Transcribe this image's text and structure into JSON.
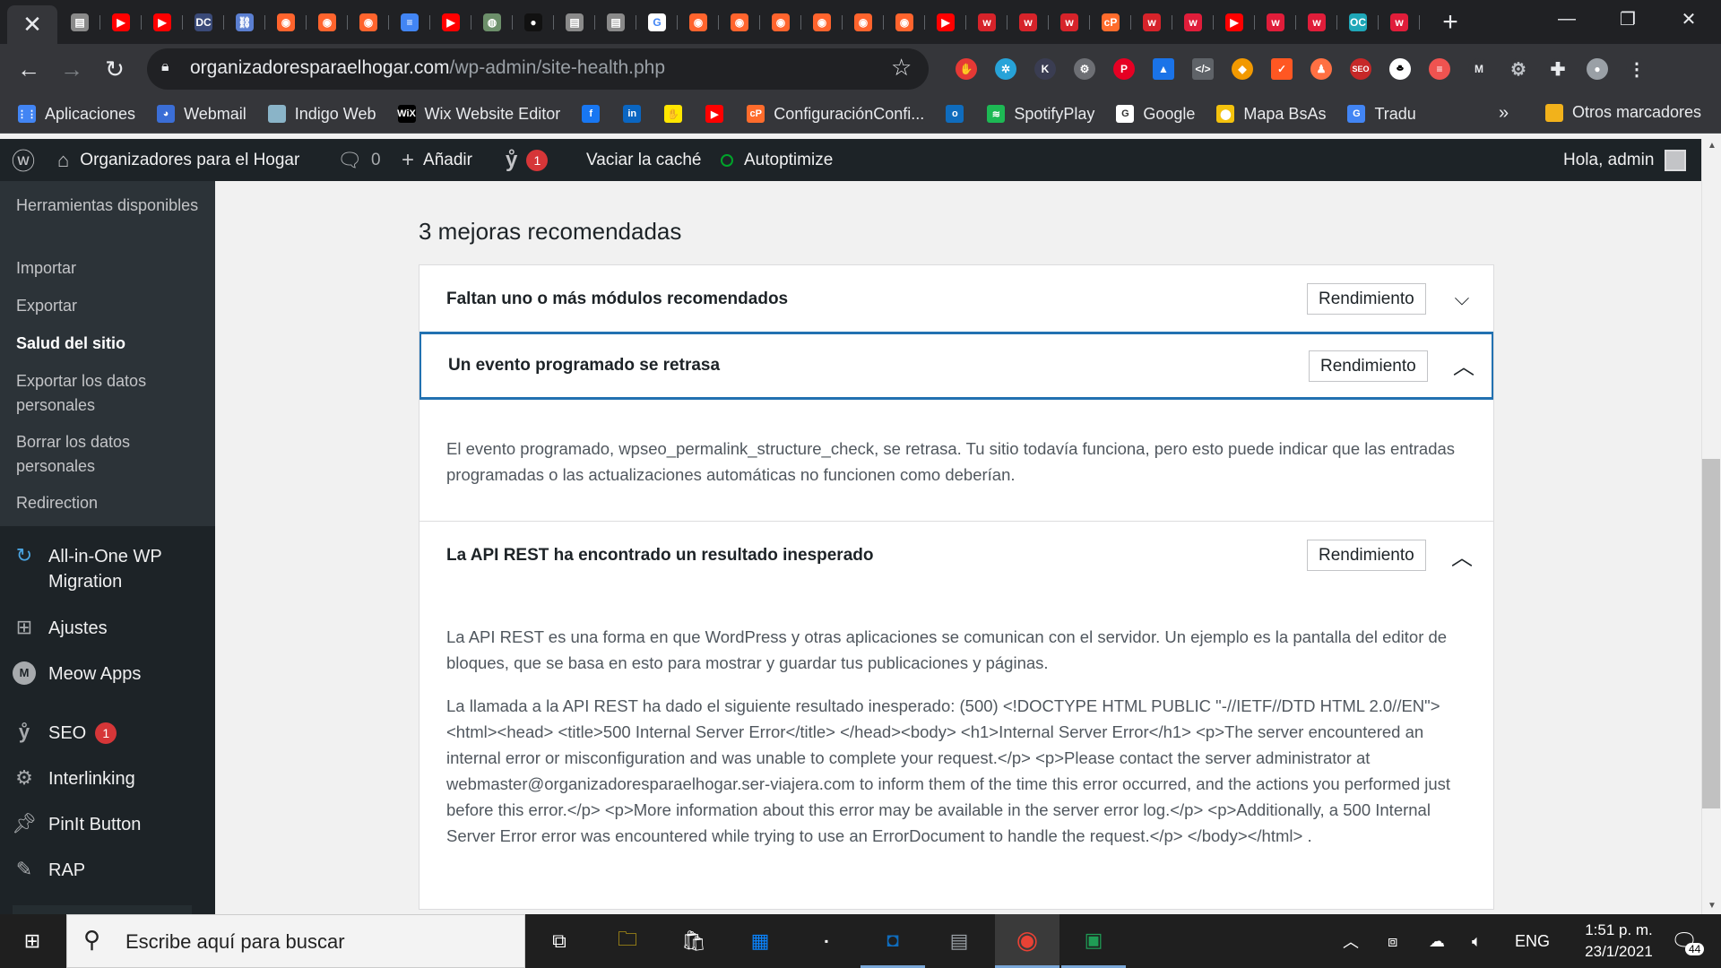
{
  "browser": {
    "tabs": [
      {
        "icon": "doc-icon",
        "color": "#8a8a8a",
        "glyph": "▤"
      },
      {
        "icon": "youtube-icon",
        "color": "#ff0000",
        "glyph": "▶"
      },
      {
        "icon": "youtube-icon",
        "color": "#ff0000",
        "glyph": "▶"
      },
      {
        "icon": "dc-icon",
        "color": "#3a4a78",
        "glyph": "DC"
      },
      {
        "icon": "link-icon",
        "color": "#5b7fd1",
        "glyph": "⛓"
      },
      {
        "icon": "semrush-icon",
        "color": "#ff642d",
        "glyph": "◉"
      },
      {
        "icon": "semrush-icon",
        "color": "#ff642d",
        "glyph": "◉"
      },
      {
        "icon": "semrush-icon",
        "color": "#ff642d",
        "glyph": "◉"
      },
      {
        "icon": "google-docs-icon",
        "color": "#4285f4",
        "glyph": "≡"
      },
      {
        "icon": "youtube-icon",
        "color": "#ff0000",
        "glyph": "▶"
      },
      {
        "icon": "globe-icon",
        "color": "#6c8f6a",
        "glyph": "◍"
      },
      {
        "icon": "dark-icon",
        "color": "#111111",
        "glyph": "●"
      },
      {
        "icon": "doc-icon",
        "color": "#8a8a8a",
        "glyph": "▤"
      },
      {
        "icon": "doc-icon",
        "color": "#8a8a8a",
        "glyph": "▤"
      },
      {
        "icon": "google-icon",
        "color": "#ffffff",
        "glyph": "G"
      },
      {
        "icon": "semrush-icon",
        "color": "#ff642d",
        "glyph": "◉"
      },
      {
        "icon": "semrush-icon",
        "color": "#ff642d",
        "glyph": "◉"
      },
      {
        "icon": "semrush-icon",
        "color": "#ff642d",
        "glyph": "◉"
      },
      {
        "icon": "semrush-icon",
        "color": "#ff642d",
        "glyph": "◉"
      },
      {
        "icon": "semrush-icon",
        "color": "#ff642d",
        "glyph": "◉"
      },
      {
        "icon": "semrush-icon",
        "color": "#ff642d",
        "glyph": "◉"
      },
      {
        "icon": "youtube-icon",
        "color": "#ff0000",
        "glyph": "▶"
      },
      {
        "icon": "w-icon",
        "color": "#d6232a",
        "glyph": "w"
      },
      {
        "icon": "w-icon",
        "color": "#d6232a",
        "glyph": "w"
      },
      {
        "icon": "w-icon",
        "color": "#d6232a",
        "glyph": "w"
      },
      {
        "icon": "cp-icon",
        "color": "#ff6c2c",
        "glyph": "cP"
      },
      {
        "icon": "w-icon",
        "color": "#d6232a",
        "glyph": "w"
      },
      {
        "icon": "w-icon",
        "color": "#e01d3a",
        "glyph": "w"
      },
      {
        "icon": "youtube-icon",
        "color": "#ff0000",
        "glyph": "▶"
      },
      {
        "icon": "w-icon",
        "color": "#e01d3a",
        "glyph": "w"
      },
      {
        "icon": "w-icon",
        "color": "#e01d3a",
        "glyph": "w"
      },
      {
        "icon": "oc-icon",
        "color": "#1fa7b8",
        "glyph": "OC"
      },
      {
        "icon": "w-icon",
        "color": "#e01d3a",
        "glyph": "w"
      }
    ],
    "address": {
      "host": "organizadoresparaelhogar.com",
      "path": "/wp-admin/site-health.php"
    },
    "bookmarks": [
      {
        "label": "Aplicaciones",
        "icon": "apps-grid-icon",
        "color": "#4285f4",
        "glyph": "⋮⋮"
      },
      {
        "label": "Webmail",
        "icon": "webmail-icon",
        "color": "#3b6ed6",
        "glyph": "◕"
      },
      {
        "label": "Indigo Web",
        "icon": "indigo-icon",
        "color": "#8ab4c8",
        "glyph": ""
      },
      {
        "label": "Wix Website Editor",
        "icon": "wix-icon",
        "color": "#000000",
        "glyph": "WiX"
      },
      {
        "label": "",
        "icon": "facebook-icon",
        "color": "#1877f2",
        "glyph": "f"
      },
      {
        "label": "",
        "icon": "linkedin-icon",
        "color": "#0a66c2",
        "glyph": "in"
      },
      {
        "label": "",
        "icon": "mercadolibre-icon",
        "color": "#ffe600",
        "glyph": "✋"
      },
      {
        "label": "",
        "icon": "youtube-icon",
        "color": "#ff0000",
        "glyph": "▶"
      },
      {
        "label": "ConfiguraciónConfi...",
        "icon": "cpanel-icon",
        "color": "#ff6c2c",
        "glyph": "cP"
      },
      {
        "label": "",
        "icon": "outlook-icon",
        "color": "#0f6cbd",
        "glyph": "o"
      },
      {
        "label": "SpotifyPlay",
        "icon": "spotify-icon",
        "color": "#1db954",
        "glyph": "≋"
      },
      {
        "label": "Google",
        "icon": "google-icon",
        "color": "#ffffff",
        "glyph": "G"
      },
      {
        "label": "Mapa BsAs",
        "icon": "map-pin-icon",
        "color": "#f4c20d",
        "glyph": "⬤"
      },
      {
        "label": "Tradu",
        "icon": "translate-icon",
        "color": "#4285f4",
        "glyph": "G"
      }
    ],
    "bookmarks_more": "»",
    "other_bookmarks": "Otros marcadores"
  },
  "adminbar": {
    "site_name": "Organizadores para el Hogar",
    "comments_count": "0",
    "add_label": "Añadir",
    "yoast_count": "1",
    "clear_cache": "Vaciar la caché",
    "autoptimize": "Autoptimize",
    "greeting": "Hola, admin"
  },
  "sidebar": {
    "submenu": [
      {
        "label": "Herramientas disponibles",
        "current": false
      },
      {
        "label": "Importar",
        "current": false
      },
      {
        "label": "Exportar",
        "current": false
      },
      {
        "label": "Salud del sitio",
        "current": true
      },
      {
        "label": "Exportar los datos personales",
        "current": false
      },
      {
        "label": "Borrar los datos personales",
        "current": false
      },
      {
        "label": "Redirection",
        "current": false
      }
    ],
    "menu": [
      {
        "label": "All-in-One WP Migration",
        "icon": "migration-icon"
      },
      {
        "label": "Ajustes",
        "icon": "settings-icon"
      },
      {
        "label": "Meow Apps",
        "icon": "meow-icon"
      },
      {
        "label": "SEO",
        "icon": "yoast-icon",
        "badge": "1"
      },
      {
        "label": "Interlinking",
        "icon": "gear-icon"
      },
      {
        "label": "PinIt Button",
        "icon": "pin-icon"
      },
      {
        "label": "RAP",
        "icon": "rap-icon"
      }
    ]
  },
  "main": {
    "heading": "3 mejoras recomendadas",
    "items": [
      {
        "title": "Faltan uno o más módulos recomendados",
        "badge": "Rendimiento",
        "expanded": false
      },
      {
        "title": "Un evento programado se retrasa",
        "badge": "Rendimiento",
        "expanded": true,
        "body": "El evento programado, wpseo_permalink_structure_check, se retrasa. Tu sitio todavía funciona, pero esto puede indicar que las entradas programadas o las actualizaciones automáticas no funcionen como deberían."
      },
      {
        "title": "La API REST ha encontrado un resultado inesperado",
        "badge": "Rendimiento",
        "expanded": true,
        "body": "La API REST es una forma en que WordPress y otras aplicaciones se comunican con el servidor. Un ejemplo es la pantalla del editor de bloques, que se basa en esto para mostrar y guardar tus publicaciones y páginas.",
        "body2": "La llamada a la API REST ha dado el siguiente resultado inesperado: (500) <!DOCTYPE HTML PUBLIC \"-//IETF//DTD HTML 2.0//EN\"> <html><head> <title>500 Internal Server Error</title> </head><body> <h1>Internal Server Error</h1> <p>The server encountered an internal error or misconfiguration and was unable to complete your request.</p> <p>Please contact the server administrator at webmaster@organizadoresparaelhogar.ser-viajera.com to inform them of the time this error occurred, and the actions you performed just before this error.</p> <p>More information about this error may be available in the server error log.</p> <p>Additionally, a 500 Internal Server Error error was encountered while trying to use an ErrorDocument to handle the request.</p> </body></html> ."
      }
    ]
  },
  "taskbar": {
    "search_placeholder": "Escribe aquí para buscar",
    "language": "ENG",
    "time": "1:51 p. m.",
    "date": "23/1/2021",
    "notifications": "44"
  },
  "colors": {
    "accent": "#2271b1",
    "wp_dark": "#1d2327",
    "badge_red": "#d63638"
  }
}
